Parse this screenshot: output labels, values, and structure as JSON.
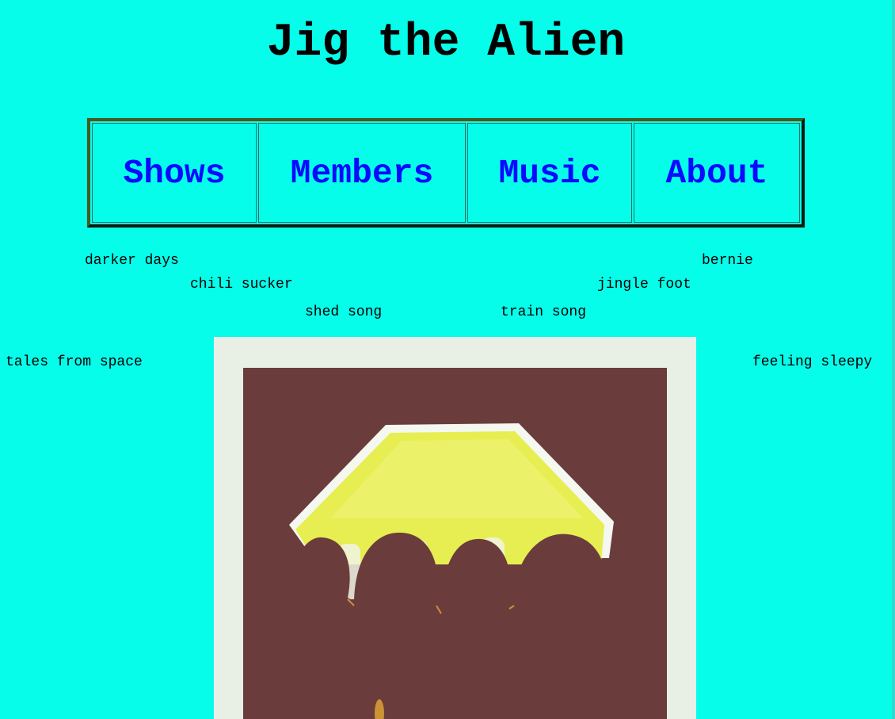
{
  "site": {
    "title": "Jig the Alien"
  },
  "nav": {
    "items": [
      {
        "label": "Shows"
      },
      {
        "label": "Members"
      },
      {
        "label": "Music"
      },
      {
        "label": "About"
      }
    ]
  },
  "songs": {
    "darker_days": "darker days",
    "chili_sucker": "chili sucker",
    "shed_song": "shed song",
    "train_song": "train song",
    "jingle_foot": "jingle foot",
    "bernie": "bernie",
    "tales_from_space": "tales from space",
    "feeling_sleepy": "feeling sleepy"
  },
  "image": {
    "alt": "polaroid photo of band silhouettes in front of a stop sign"
  },
  "colors": {
    "background": "#06fdea",
    "link": "#0a0aff",
    "text": "#000000"
  }
}
